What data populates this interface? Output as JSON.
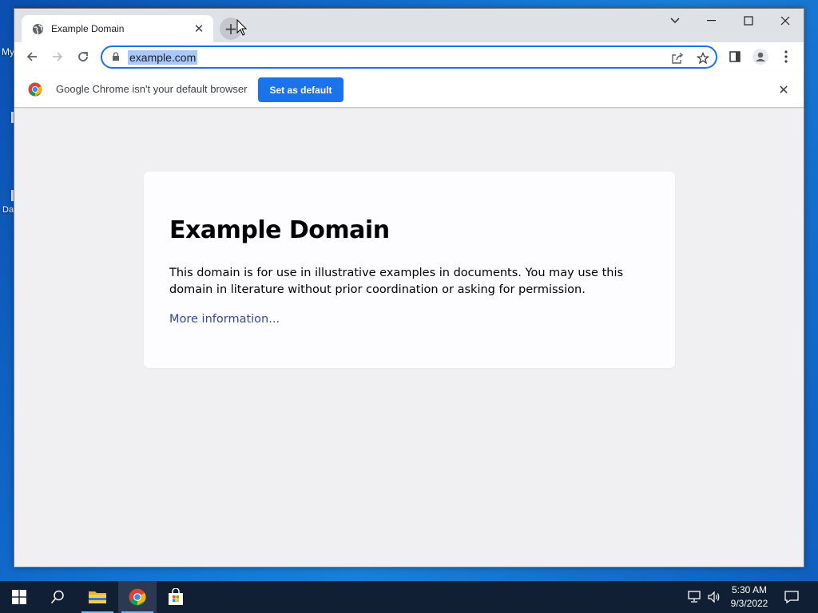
{
  "desktop": {
    "icon_label_1": "My",
    "icon_label_2": "Da"
  },
  "browser": {
    "tab": {
      "title": "Example Domain",
      "favicon": "globe-icon",
      "close_icon": "close-icon"
    },
    "new_tab_icon": "plus-icon",
    "window_controls": [
      "chevron-down-icon",
      "minimize-icon",
      "maximize-icon",
      "close-icon"
    ],
    "toolbar": {
      "back_icon": "back-arrow-icon",
      "forward_icon": "forward-arrow-icon",
      "reload_icon": "reload-icon",
      "url": "example.com",
      "share_icon": "share-icon",
      "bookmark_icon": "star-icon",
      "side_panel_icon": "side-panel-icon",
      "profile_icon": "profile-icon",
      "menu_icon": "kebab-menu-icon"
    },
    "infobar": {
      "message": "Google Chrome isn't your default browser",
      "button_label": "Set as default",
      "close_icon": "close-icon"
    }
  },
  "page": {
    "heading": "Example Domain",
    "body": "This domain is for use in illustrative examples in documents. You may use this domain in literature without prior coordination or asking for permission.",
    "link": "More information..."
  },
  "taskbar": {
    "items": [
      "windows-start-icon",
      "search-icon",
      "file-explorer-icon",
      "chrome-icon",
      "microsoft-store-icon"
    ],
    "tray": [
      "network-icon",
      "volume-icon",
      "notification-icon"
    ],
    "time": "5:30 AM",
    "date": "9/3/2022"
  },
  "colors": {
    "accent": "#1a73e8",
    "link": "#38488f",
    "taskbar": "#101f33"
  }
}
